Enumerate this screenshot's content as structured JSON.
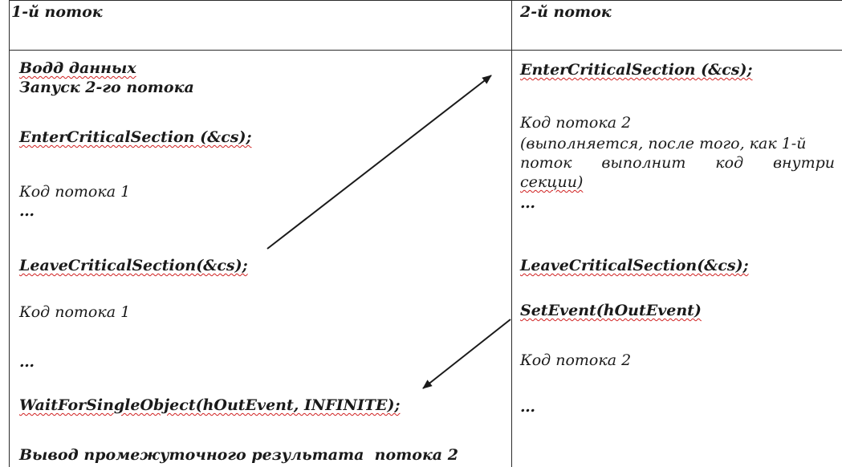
{
  "colors": {
    "line": "#2b2b2b",
    "text": "#1a1a1a",
    "squiggle": "#d02020"
  },
  "headers": {
    "col1": "1-й поток",
    "col2": "2-й поток"
  },
  "col1": {
    "input": "Водд данных",
    "launch": "Запуск 2-го потока",
    "enter_cs": "EnterCriticalSection (&cs);",
    "code1a": "Код потока 1",
    "dots1": "…",
    "leave_cs": "LeaveCriticalSection(&cs);",
    "code1b": "Код потока 1",
    "dots2": "…",
    "wait": "WaitForSingleObject(hOutEvent, INFINITE);",
    "output": "Вывод промежуточного результата  потока 2"
  },
  "col2": {
    "enter_cs": "EnterCriticalSection (&cs);",
    "code2a": "Код потока 2",
    "note_l1": "(выполняется, после того, как 1-й",
    "note_l2_words": [
      "поток",
      "выполнит",
      "код",
      "внутри"
    ],
    "note_l3": "секции)",
    "dots1": "…",
    "leave_cs": "LeaveCriticalSection(&cs);",
    "set_event": "SetEvent(hOutEvent)",
    "code2b": "Код потока 2",
    "dots2": "…"
  }
}
